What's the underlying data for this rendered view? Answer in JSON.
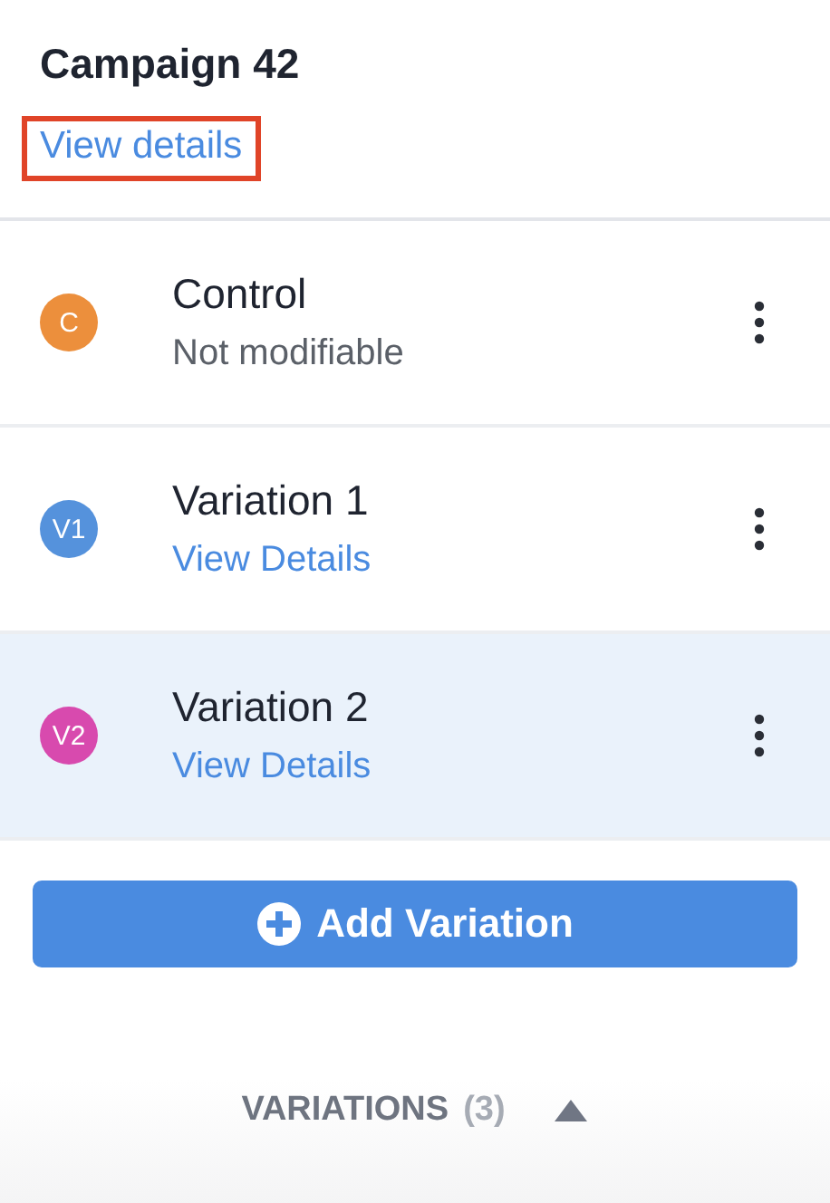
{
  "header": {
    "title": "Campaign 42",
    "link": {
      "label": "View details",
      "highlighted": true
    }
  },
  "variations": [
    {
      "initials": "C",
      "color": "#ec8f3c",
      "name": "Control",
      "subtitle": "Not modifiable",
      "kind": "note",
      "selected": false
    },
    {
      "initials": "V1",
      "color": "#5592dc",
      "name": "Variation 1",
      "subtitle": "View Details",
      "kind": "link",
      "selected": false
    },
    {
      "initials": "V2",
      "color": "#d84aae",
      "name": "Variation 2",
      "subtitle": "View Details",
      "kind": "link",
      "selected": true
    }
  ],
  "add_button": {
    "label": "Add Variation"
  },
  "footer": {
    "label": "VARIATIONS",
    "count": "(3)",
    "expanded": true
  }
}
